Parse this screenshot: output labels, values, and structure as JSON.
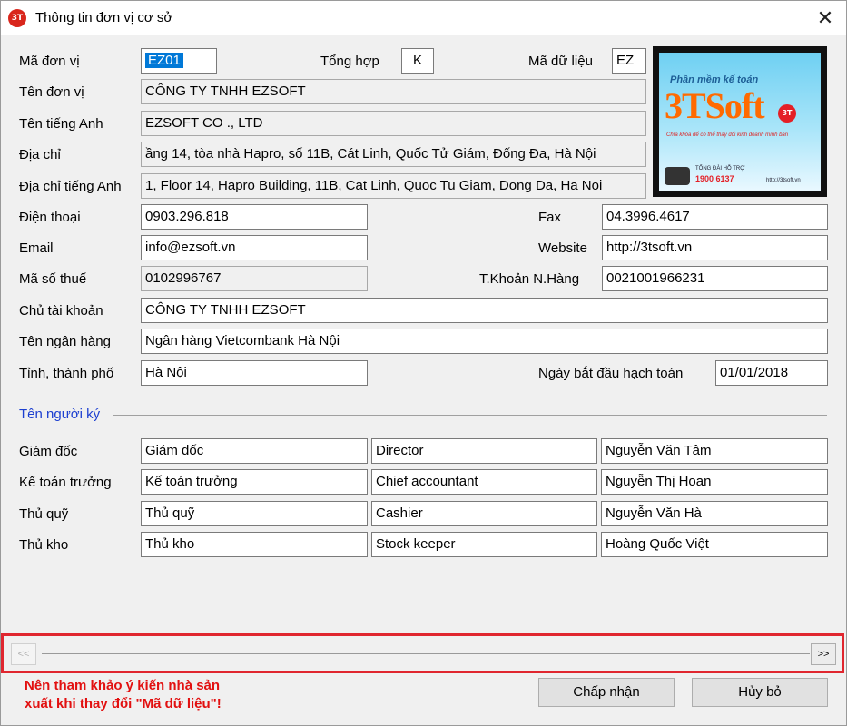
{
  "window": {
    "title": "Thông tin đơn vị cơ sở",
    "close_glyph": "✕",
    "icon": "app-3t-icon"
  },
  "fields": {
    "ma_don_vi": {
      "label": "Mã đơn vị",
      "value": "EZ01"
    },
    "tong_hop": {
      "label": "Tổng hợp",
      "value": "K"
    },
    "ma_du_lieu": {
      "label": "Mã dữ liệu",
      "value": "EZ"
    },
    "ten_don_vi": {
      "label": "Tên đơn vị",
      "value": "CÔNG TY TNHH EZSOFT"
    },
    "ten_tieng_anh": {
      "label": "Tên tiếng Anh",
      "value": "EZSOFT CO ., LTD"
    },
    "dia_chi": {
      "label": "Địa chỉ",
      "value": "ầng 14, tòa nhà Hapro, số 11B, Cát Linh, Quốc Tử Giám, Đống Đa, Hà Nội"
    },
    "dia_chi_tieng_anh": {
      "label": "Địa chỉ tiếng Anh",
      "value": "1, Floor 14, Hapro Building, 11B, Cat Linh, Quoc Tu Giam, Dong Da, Ha Noi"
    },
    "dien_thoai": {
      "label": "Điện thoại",
      "value": "0903.296.818"
    },
    "fax": {
      "label": "Fax",
      "value": "04.3996.4617"
    },
    "email": {
      "label": "Email",
      "value": "info@ezsoft.vn"
    },
    "website": {
      "label": "Website",
      "value": "http://3tsoft.vn"
    },
    "ma_so_thue": {
      "label": "Mã số thuế",
      "value": "0102996767"
    },
    "tai_khoan_ngan_hang": {
      "label": "T.Khoản N.Hàng",
      "value": "0021001966231"
    },
    "chu_tai_khoan": {
      "label": "Chủ tài khoản",
      "value": "CÔNG TY TNHH EZSOFT"
    },
    "ten_ngan_hang": {
      "label": "Tên ngân hàng",
      "value": "Ngân hàng Vietcombank Hà Nội"
    },
    "tinh_thanh_pho": {
      "label": "Tỉnh, thành phố",
      "value": "Hà Nội"
    },
    "ngay_bat_dau": {
      "label": "Ngày bắt đầu hạch toán",
      "value": "01/01/2018"
    }
  },
  "logo": {
    "sub": "Phần mềm kế toán",
    "brand": "3TSoft",
    "badge": "3T",
    "tagline": "Chìa khóa để có thể thay đổi kinh doanh mình bạn",
    "hotline_label": "TỔNG ĐÀI HỖ TRỢ",
    "hotline": "1900 6137",
    "url": "http://3tsoft.vn"
  },
  "signers": {
    "section_title": "Tên người ký",
    "rows": [
      {
        "label": "Giám đốc",
        "title_vi": "Giám đốc",
        "title_en": "Director",
        "name": "Nguyễn Văn Tâm"
      },
      {
        "label": "Kế toán trưởng",
        "title_vi": "Kế toán trưởng",
        "title_en": "Chief accountant",
        "name": "Nguyễn Thị Hoan"
      },
      {
        "label": "Thủ quỹ",
        "title_vi": "Thủ quỹ",
        "title_en": "Cashier",
        "name": "Nguyễn Văn Hà"
      },
      {
        "label": "Thủ kho",
        "title_vi": "Thủ kho",
        "title_en": "Stock keeper",
        "name": "Hoàng Quốc Việt"
      }
    ]
  },
  "pager": {
    "prev": "<<",
    "next": ">>"
  },
  "warning": "Nên tham khảo ý kiến nhà sản\nxuất khi thay đổi \"Mã dữ liệu\"!",
  "buttons": {
    "accept": "Chấp nhận",
    "cancel": "Hủy bỏ"
  },
  "colors": {
    "highlight_border": "#e0262f",
    "warning_text": "#e21010",
    "section_title": "#1c3fd0",
    "selection": "#0078d7"
  }
}
